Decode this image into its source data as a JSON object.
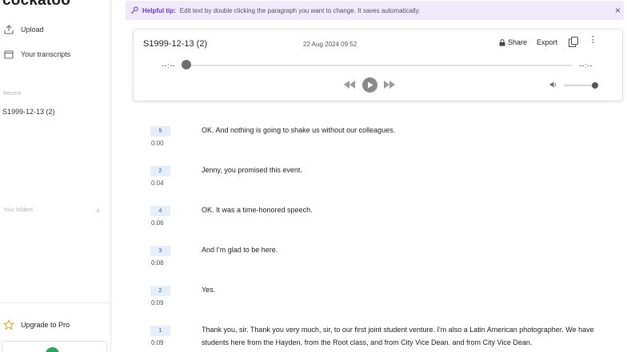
{
  "app": {
    "logo": "cockatoo"
  },
  "sidebar": {
    "upload": "Upload",
    "transcripts": "Your transcripts",
    "recent_heading": "Recent",
    "recent_items": [
      "S1999-12-13 (2)"
    ],
    "folders_heading": "Your folders",
    "upgrade": "Upgrade to Pro"
  },
  "tip": {
    "label": "Helpful tip:",
    "message": "Edit text by double clicking the paragraph you want to change. It saves automatically."
  },
  "player": {
    "title": "S1999-12-13 (2)",
    "date": "22 Aug 2024 09:52",
    "share": "Share",
    "export": "Export",
    "time_elapsed": "--:--",
    "time_total": "--:--",
    "progress": 0,
    "volume": 1.0
  },
  "segments": [
    {
      "speaker": "5",
      "time": "0:00",
      "text": "OK. And nothing is going to shake us without our colleagues."
    },
    {
      "speaker": "2",
      "time": "0:04",
      "text": "Jenny, you promised this event."
    },
    {
      "speaker": "4",
      "time": "0:06",
      "text": "OK. It was a time-honored speech."
    },
    {
      "speaker": "3",
      "time": "0:08",
      "text": "And I'm glad to be here."
    },
    {
      "speaker": "2",
      "time": "0:09",
      "text": "Yes."
    },
    {
      "speaker": "1",
      "time": "0:09",
      "text": "Thank you, sir. Thank you very much, sir, to our first joint student venture. I'm also a Latin American photographer. We have students here from the Hayden, from the Root class, and from City Vice Dean. and from City Vice Dean."
    }
  ],
  "colors": {
    "accent": "#6a3cc9",
    "tip_bg": "#efe9fb",
    "speaker_bg": "#e5effa",
    "success": "#27a559"
  }
}
